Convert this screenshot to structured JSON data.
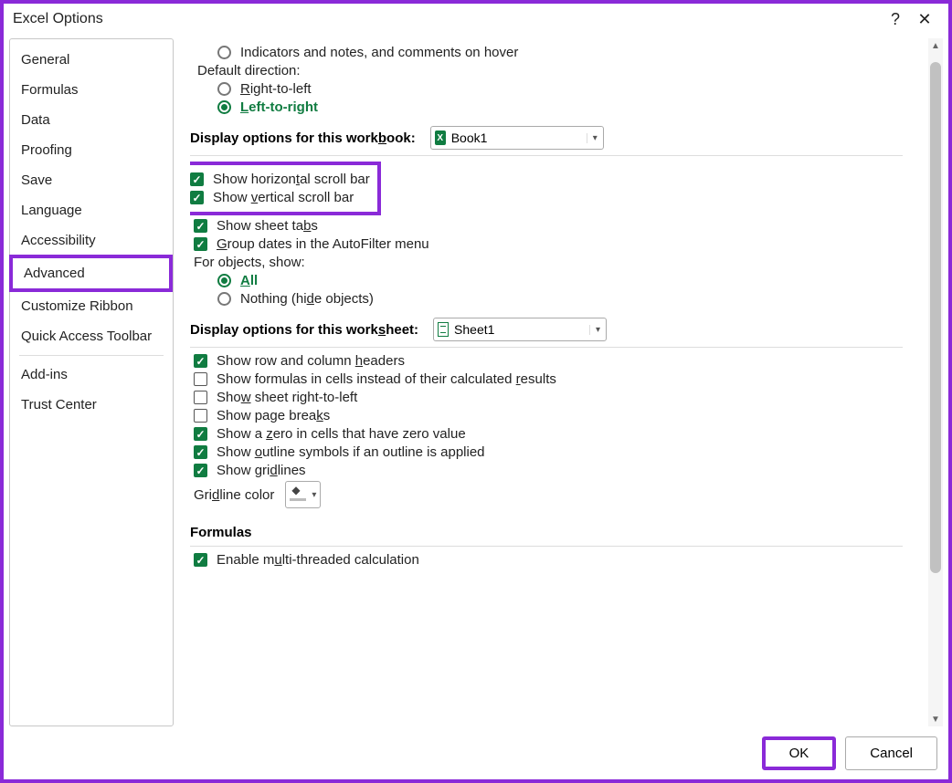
{
  "title": "Excel Options",
  "titlebar": {
    "help": "?",
    "close": "✕"
  },
  "sidebar": {
    "items": [
      {
        "label": "General"
      },
      {
        "label": "Formulas"
      },
      {
        "label": "Data"
      },
      {
        "label": "Proofing"
      },
      {
        "label": "Save"
      },
      {
        "label": "Language"
      },
      {
        "label": "Accessibility"
      },
      {
        "label": "Advanced",
        "selected": true
      },
      {
        "label": "Customize Ribbon"
      },
      {
        "label": "Quick Access Toolbar"
      },
      {
        "sep": true
      },
      {
        "label": "Add-ins"
      },
      {
        "label": "Trust Center"
      }
    ]
  },
  "top": {
    "indicators_label": "Indicators and notes, and comments on hover",
    "default_dir": "Default direction:",
    "rtl": "Right-to-left",
    "ltr": "Left-to-right"
  },
  "workbook_section": {
    "title": "Display options for this workbook:",
    "dropdown": "Book1",
    "show_h": "Show horizontal scroll bar",
    "show_v": "Show vertical scroll bar",
    "show_tabs": "Show sheet tabs",
    "group_dates": "Group dates in the AutoFilter menu",
    "for_objects": "For objects, show:",
    "all": "All",
    "nothing": "Nothing (hide objects)"
  },
  "worksheet_section": {
    "title": "Display options for this worksheet:",
    "dropdown": "Sheet1",
    "row_col": "Show row and column headers",
    "formulas": "Show formulas in cells instead of their calculated results",
    "rtl_sheet": "Show sheet right-to-left",
    "page_breaks": "Show page breaks",
    "zero": "Show a zero in cells that have zero value",
    "outline": "Show outline symbols if an outline is applied",
    "gridlines": "Show gridlines",
    "gridline_color": "Gridline color"
  },
  "formulas_section": {
    "title": "Formulas",
    "multi": "Enable multi-threaded calculation"
  },
  "footer": {
    "ok": "OK",
    "cancel": "Cancel"
  }
}
